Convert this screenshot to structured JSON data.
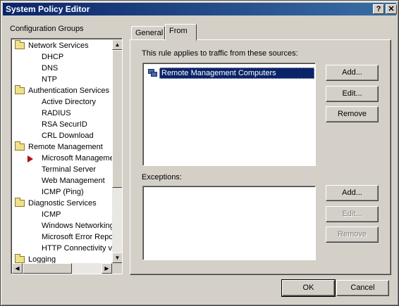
{
  "window": {
    "title": "System Policy Editor",
    "help": "?",
    "close": "✕"
  },
  "groups": {
    "label": "Configuration Groups",
    "tree": [
      {
        "label": "Network Services",
        "type": "folder"
      },
      {
        "label": "DHCP",
        "type": "leaf"
      },
      {
        "label": "DNS",
        "type": "leaf"
      },
      {
        "label": "NTP",
        "type": "leaf"
      },
      {
        "label": "Authentication Services",
        "type": "folder"
      },
      {
        "label": "Active Directory",
        "type": "leaf"
      },
      {
        "label": "RADIUS",
        "type": "leaf"
      },
      {
        "label": "RSA SecurID",
        "type": "leaf"
      },
      {
        "label": "CRL Download",
        "type": "leaf"
      },
      {
        "label": "Remote Management",
        "type": "folder"
      },
      {
        "label": "Microsoft Manageme",
        "type": "leaf",
        "selected": true
      },
      {
        "label": "Terminal Server",
        "type": "leaf"
      },
      {
        "label": "Web Management",
        "type": "leaf"
      },
      {
        "label": "ICMP (Ping)",
        "type": "leaf"
      },
      {
        "label": "Diagnostic Services",
        "type": "folder"
      },
      {
        "label": "ICMP",
        "type": "leaf"
      },
      {
        "label": "Windows Networking",
        "type": "leaf"
      },
      {
        "label": "Microsoft Error Repo",
        "type": "leaf"
      },
      {
        "label": "HTTP Connectivity ve",
        "type": "leaf"
      },
      {
        "label": "Logging",
        "type": "folder"
      }
    ]
  },
  "tabs": [
    {
      "label": "General"
    },
    {
      "label": "From",
      "active": true
    }
  ],
  "from": {
    "applies_label": "This rule applies to traffic from these sources:",
    "sources": [
      {
        "label": "Remote Management Computers",
        "icon": "computers-icon"
      }
    ],
    "source_buttons": {
      "add": "Add...",
      "edit": "Edit...",
      "remove": "Remove"
    },
    "exceptions_label": "Exceptions:",
    "exception_buttons": {
      "add": "Add...",
      "edit": "Edit...",
      "remove": "Remove"
    }
  },
  "footer": {
    "ok": "OK",
    "cancel": "Cancel"
  },
  "colors": {
    "selection": "#0a246a",
    "face": "#d4d0c8",
    "title_start": "#0a246a",
    "title_end": "#3a6ea5"
  }
}
